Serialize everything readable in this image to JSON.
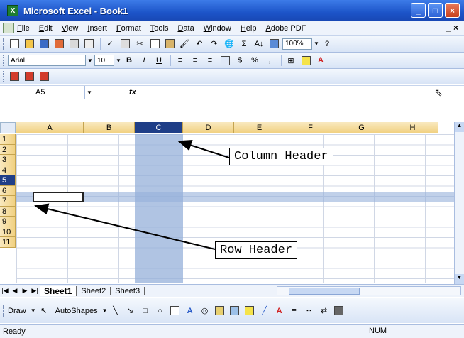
{
  "window": {
    "title": "Microsoft Excel - Book1",
    "app_icon_label": "X"
  },
  "menubar": {
    "items": [
      "File",
      "Edit",
      "View",
      "Insert",
      "Format",
      "Tools",
      "Data",
      "Window",
      "Help",
      "Adobe PDF"
    ],
    "controls": "_ ×"
  },
  "toolbar": {
    "zoom": "100%",
    "sigma": "Σ",
    "sort": "A↓"
  },
  "format_toolbar": {
    "font_name": "Arial",
    "font_size": "10",
    "bold": "B",
    "italic": "I",
    "underline": "U",
    "currency": "$",
    "percent": "%"
  },
  "formula_bar": {
    "name_box": "A5",
    "fx": "fx"
  },
  "grid": {
    "columns": [
      "A",
      "B",
      "C",
      "D",
      "E",
      "F",
      "G",
      "H"
    ],
    "rows": [
      "1",
      "2",
      "3",
      "4",
      "5",
      "6",
      "7",
      "8",
      "9",
      "10",
      "11"
    ],
    "selected_column": "C",
    "selected_row": "5",
    "active_cell": "A5"
  },
  "annotations": {
    "column_header": "Column Header",
    "row_header": "Row Header"
  },
  "sheet_tabs": [
    "Sheet1",
    "Sheet2",
    "Sheet3"
  ],
  "drawbar": {
    "draw": "Draw",
    "autoshapes": "AutoShapes"
  },
  "status": {
    "left": "Ready",
    "num": "NUM"
  },
  "colors": {
    "title_blue": "#1c54c8",
    "header_gold": "#f1d182",
    "selected_header": "#1f3e87",
    "selection_fill": "#96b0da"
  }
}
